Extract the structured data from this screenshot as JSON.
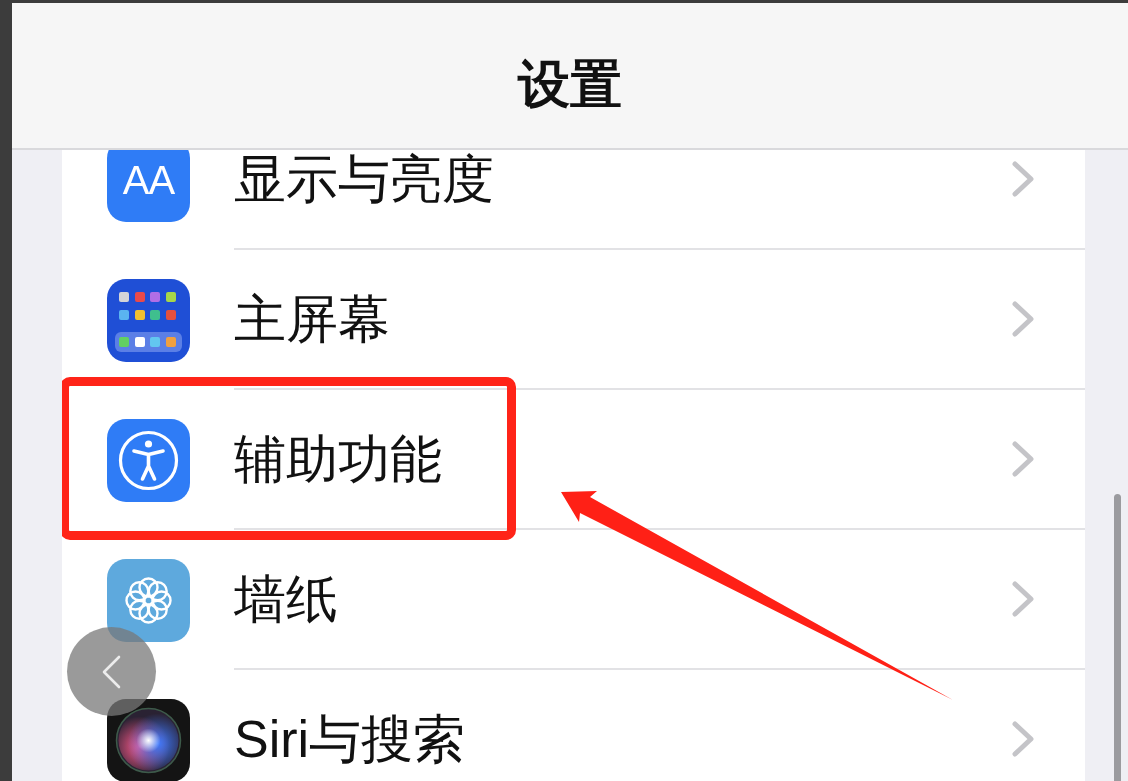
{
  "navigation": {
    "title": "设置"
  },
  "settings": [
    {
      "label": "显示与亮度",
      "kind": "text-size",
      "icon_text": "AA",
      "highlighted": false
    },
    {
      "label": "主屏幕",
      "kind": "home-grid",
      "highlighted": false
    },
    {
      "label": "辅助功能",
      "kind": "accessibility",
      "highlighted": true
    },
    {
      "label": "墙纸",
      "kind": "flower",
      "highlighted": false
    },
    {
      "label": "Siri与搜索",
      "kind": "siri",
      "highlighted": false
    }
  ]
}
